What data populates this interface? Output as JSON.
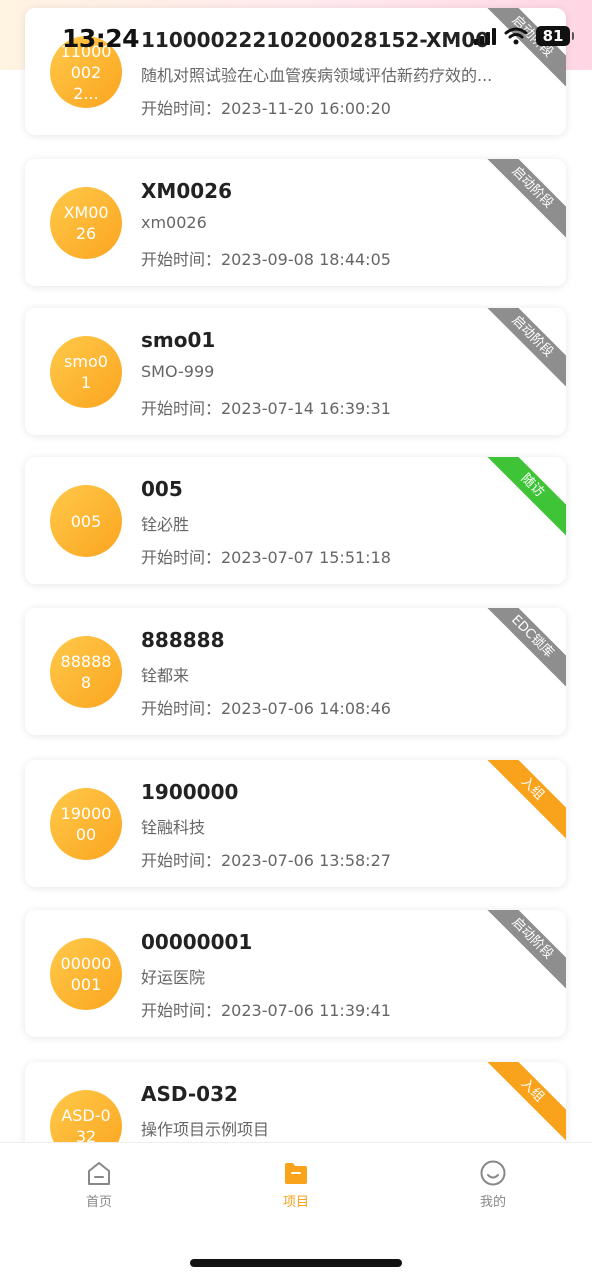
{
  "status_bar": {
    "time": "13:24",
    "battery": "81"
  },
  "projects": [
    {
      "avatar": "110000022...",
      "title": "11000022210200028152-XM00",
      "subtitle": "随机对照试验在心血管疾病领域评估新药疗效的...",
      "start_time": "开始时间：2023-11-20 16:00:20",
      "stage": "启动阶段",
      "stage_color": "gray"
    },
    {
      "avatar": "XM0026",
      "title": "XM0026",
      "subtitle": "xm0026",
      "start_time": "开始时间：2023-09-08 18:44:05",
      "stage": "启动阶段",
      "stage_color": "gray"
    },
    {
      "avatar": "smo01",
      "title": "smo01",
      "subtitle": "SMO-999",
      "start_time": "开始时间：2023-07-14 16:39:31",
      "stage": "启动阶段",
      "stage_color": "gray"
    },
    {
      "avatar": "005",
      "title": "005",
      "subtitle": "铨必胜",
      "start_time": "开始时间：2023-07-07 15:51:18",
      "stage": "随访",
      "stage_color": "green"
    },
    {
      "avatar": "888888",
      "title": "888888",
      "subtitle": "铨都来",
      "start_time": "开始时间：2023-07-06 14:08:46",
      "stage": "EDC锁库",
      "stage_color": "gray"
    },
    {
      "avatar": "1900000",
      "title": "1900000",
      "subtitle": "铨融科技",
      "start_time": "开始时间：2023-07-06 13:58:27",
      "stage": "入组",
      "stage_color": "orange"
    },
    {
      "avatar": "00000001",
      "title": "00000001",
      "subtitle": "好运医院",
      "start_time": "开始时间：2023-07-06 11:39:41",
      "stage": "启动阶段",
      "stage_color": "gray"
    },
    {
      "avatar": "ASD-032",
      "title": "ASD-032",
      "subtitle": "操作项目示例项目",
      "start_time": "",
      "stage": "入组",
      "stage_color": "orange"
    }
  ],
  "tabbar": {
    "home": {
      "label": "首页",
      "icon": "home-icon"
    },
    "projects": {
      "label": "项目",
      "icon": "folder-icon"
    },
    "mine": {
      "label": "我的",
      "icon": "smile-face-icon"
    }
  },
  "colors": {
    "accent": "#f9a21b",
    "gray_badge": "#8e8e8e",
    "green_badge": "#3fc437"
  }
}
